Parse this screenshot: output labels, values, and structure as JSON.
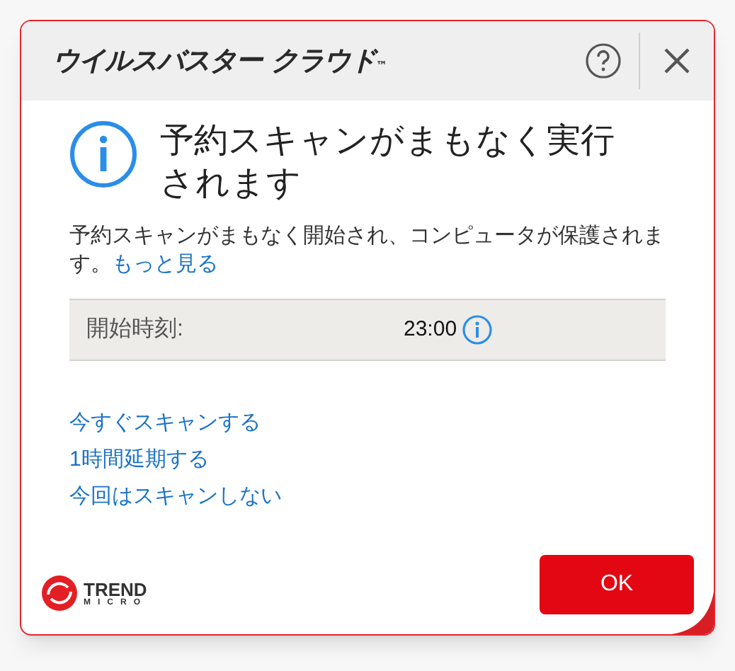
{
  "window": {
    "title": "ウイルスバスター クラウド",
    "trademark": "™"
  },
  "message": {
    "heading": "予約スキャンがまもなく実行されます",
    "body": "予約スキャンがまもなく開始され、コンピュータが保護されます。",
    "link": "もっと見る"
  },
  "schedule": {
    "label": "開始時刻:",
    "value": "23:00"
  },
  "actions": [
    "今すぐスキャンする",
    "1時間延期する",
    "今回はスキャンしない"
  ],
  "footer": {
    "logo_top": "TREND",
    "logo_bottom": "MICRO",
    "ok": "OK"
  }
}
